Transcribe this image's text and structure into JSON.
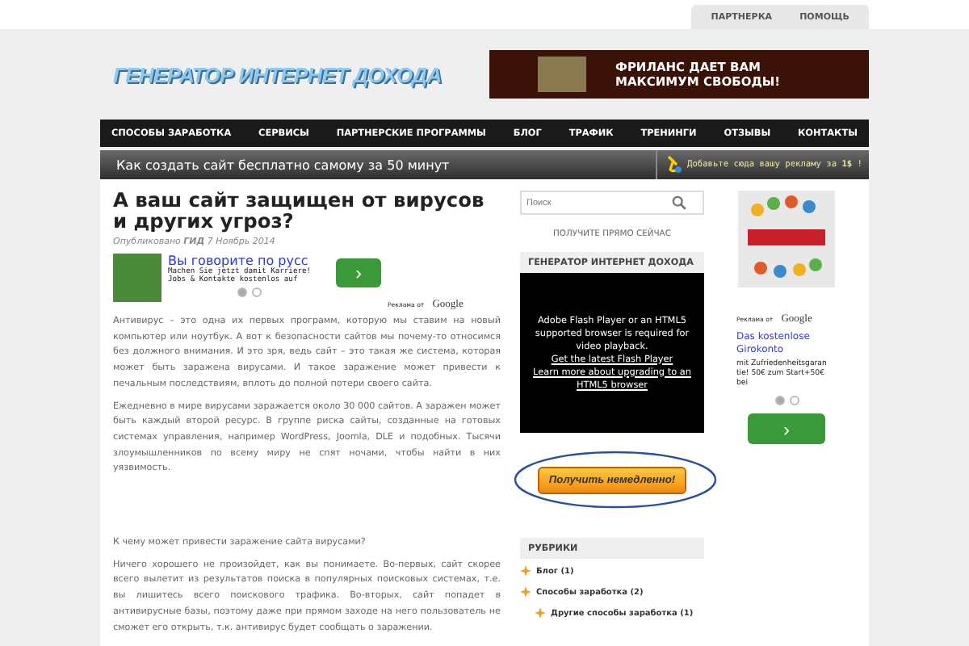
{
  "top_links": [
    "ПАРТНЕРКА",
    "ПОМОЩЬ"
  ],
  "logo": "ГЕНЕРАТОР ИНТЕРНЕТ ДОХОДА",
  "banner": {
    "text": "ФРИЛАНС ДАЕТ ВАМ МАКСИМУМ СВОБОДЫ!"
  },
  "nav": [
    "СПОСОБЫ ЗАРАБОТКА",
    "СЕРВИСЫ",
    "ПАРТНЕРСКИЕ ПРОГРАММЫ",
    "БЛОГ",
    "ТРАФИК",
    "ТРЕНИНГИ",
    "ОТЗЫВЫ",
    "КОНТАКТЫ"
  ],
  "subbar": {
    "headline": "Как создать сайт бесплатно самому за 50 минут",
    "promo": "Добавьте сюда вашу рекламу за **1$** !"
  },
  "article": {
    "title": "А ваш сайт защищен от вирусов и других угроз?",
    "meta": "Опубликовано **ГИД** 7 Ноябрь 2014",
    "ad": {
      "title": "Вы говорите по русс",
      "lines": [
        "Machen Sie jetzt damit Karriere!",
        "Jobs & Kontakte kostenlos auf"
      ],
      "button": "›",
      "label": "Реклама от",
      "brand": "Google",
      "slides": [
        {
          "selected": true
        },
        {
          "selected": false
        }
      ]
    },
    "paragraphs": [
      "Антивирус – это одна их первых программ, которую мы ставим на новый компьютер или ноутбук. А вот к безопасности сайтов мы почему-то относимся без должного внимания. И это зря, ведь сайт – это такая же система, которая может быть заражена вирусами. И такое заражение может привести к печальным последствиям, вплоть до полной потери своего сайта.",
      "Ежедневно в мире вирусами заражается около 30 000 сайтов. А заражен может быть каждый второй ресурс. В группе риска сайты, созданные на готовых системах управления, например WordPress, Joomla, DLE и подобных. Тысячи злоумышленников по всему миру не спят ночами, чтобы найти в них уязвимость."
    ],
    "question": "К чему может привести заражение сайта вирусами?",
    "paragraph_after": "Ничего хорошего не произойдет, как вы понимаете. Во-первых, сайт скорее всего вылетит из результатов поиска в популярных поисковых системах, т.е. вы лишитесь всего поискового трафика. Во-вторых, сайт попадет в антивирусные базы, поэтому даже при прямом заходе на него пользователь не сможет его открыть, т.к. антивирус будет сообщать о заражении."
  },
  "sidebar": {
    "search": {
      "placeholder": "Поиск"
    },
    "promo_caption": "ПОЛУЧИТЕ ПРЯМО СЕЙЧАС",
    "widget_title": "ГЕНЕРАТОР ИНТЕРНЕТ ДОХОДА",
    "video": {
      "message": "Adobe Flash Player or an HTML5 supported browser is required for video playback.",
      "links": [
        "Get the latest Flash Player",
        "Learn more about upgrading to an HTML5 browser"
      ]
    },
    "cta_button": "Получить немедленно!",
    "categories_title": "РУБРИКИ",
    "categories": [
      {
        "label": "Блог (1)"
      },
      {
        "label": "Способы заработка (2)",
        "children": [
          {
            "label": "Другие способы заработка (1)"
          }
        ]
      }
    ]
  },
  "side_ad": {
    "label": "Реклама от",
    "brand": "Google",
    "title": "Das kostenlose Girokonto",
    "text": "mit Zufriedenheitsgaran tie! 50€ zum Start+50€ bei",
    "slides": [
      {
        "selected": true
      },
      {
        "selected": false
      }
    ],
    "button": "›"
  }
}
